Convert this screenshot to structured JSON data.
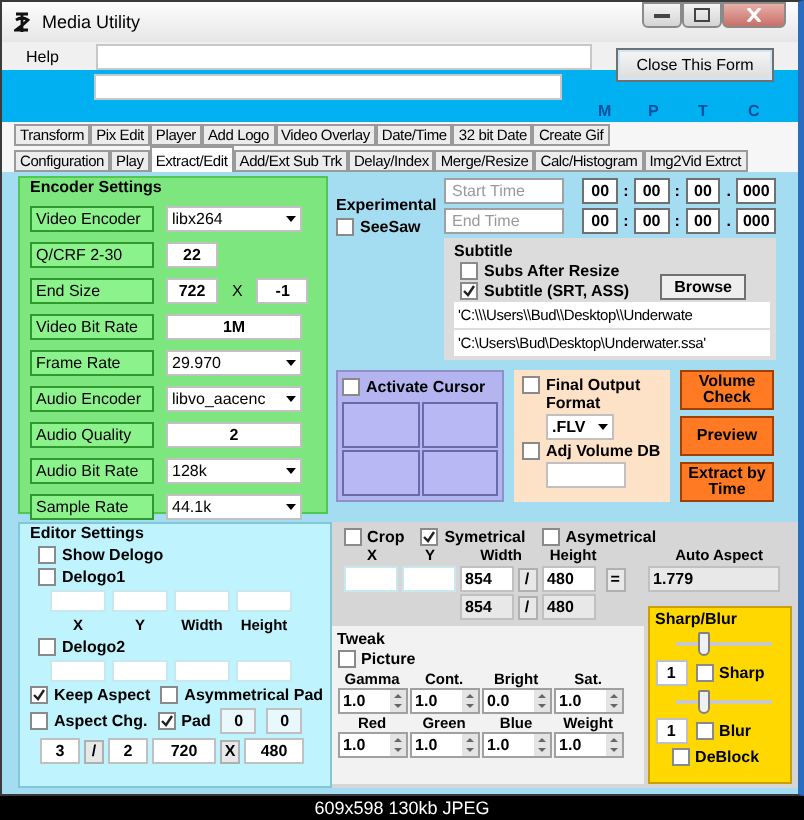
{
  "window": {
    "title": "Media Utility"
  },
  "menu": [
    {
      "label": "Help"
    }
  ],
  "close_button": "Close This Form",
  "indicators": [
    "M",
    "P",
    "T",
    "C"
  ],
  "tabs_row1": [
    {
      "label": "Transform",
      "selected": false
    },
    {
      "label": "Pix Edit",
      "selected": false
    },
    {
      "label": "Player",
      "selected": false
    },
    {
      "label": "Add Logo",
      "selected": false
    },
    {
      "label": "Video Overlay",
      "selected": false
    },
    {
      "label": "Date/Time",
      "selected": false
    },
    {
      "label": "32 bit Date",
      "selected": false
    },
    {
      "label": "Create Gif",
      "selected": false
    }
  ],
  "tabs_row2": [
    {
      "label": "Configuration",
      "selected": false
    },
    {
      "label": "Play",
      "selected": false
    },
    {
      "label": "Extract/Edit",
      "selected": true
    },
    {
      "label": "Add/Ext Sub Trk",
      "selected": false
    },
    {
      "label": "Delay/Index",
      "selected": false
    },
    {
      "label": "Merge/Resize",
      "selected": false
    },
    {
      "label": "Calc/Histogram",
      "selected": false
    },
    {
      "label": "Img2Vid Extrct",
      "selected": false
    }
  ],
  "encoder_settings": {
    "title": "Encoder Settings",
    "rows": [
      {
        "label": "Video Encoder",
        "kind": "dropdown",
        "value": "libx264"
      },
      {
        "label": "Q/CRF  2-30",
        "kind": "short",
        "value": "22"
      },
      {
        "label": "End Size",
        "kind": "size",
        "value": "722",
        "separator": "X",
        "value2": "-1"
      },
      {
        "label": "Video Bit Rate",
        "kind": "field",
        "value": "1M"
      },
      {
        "label": "Frame Rate",
        "kind": "dropdown",
        "value": "29.970"
      },
      {
        "label": "Audio Encoder",
        "kind": "dropdown",
        "value": "libvo_aacenc"
      },
      {
        "label": "Audio Quality",
        "kind": "field",
        "value": "2"
      },
      {
        "label": "Audio Bit Rate",
        "kind": "dropdown",
        "value": "128k"
      },
      {
        "label": "Sample Rate",
        "kind": "dropdown",
        "value": "44.1k"
      }
    ]
  },
  "experimental": {
    "label": "Experimental",
    "seesaw": {
      "label": "SeeSaw",
      "checked": false
    }
  },
  "times": [
    {
      "placeholder": "Start Time",
      "parts": [
        "00",
        "00",
        "00",
        "000"
      ]
    },
    {
      "placeholder": "End Time",
      "parts": [
        "00",
        "00",
        "00",
        "000"
      ]
    }
  ],
  "time_separators": [
    ":",
    ":",
    "."
  ],
  "subtitle": {
    "title": "Subtitle",
    "checks": [
      {
        "label": "Subs After Resize",
        "checked": false
      },
      {
        "label": "Subtitle (SRT, ASS)",
        "checked": true
      }
    ],
    "browse": "Browse",
    "paths": [
      "'C:\\\\\\Users\\\\Bud\\\\Desktop\\\\Underwate",
      "'C:\\Users\\Bud\\Desktop\\Underwater.ssa'"
    ]
  },
  "cursor": {
    "label": "Activate Cursor",
    "checked": false
  },
  "output": {
    "final": {
      "label": "Final Output Format",
      "checked": false
    },
    "format": ".FLV",
    "volume": {
      "label": "Adj Volume DB",
      "checked": false
    }
  },
  "actions": [
    "Volume Check",
    "Preview",
    "Extract by Time"
  ],
  "editor": {
    "title": "Editor Settings",
    "show_delogo": {
      "label": "Show Delogo",
      "checked": false
    },
    "delogo1": {
      "label": "Delogo1",
      "checked": false
    },
    "coord_labels": [
      "X",
      "Y",
      "Width",
      "Height"
    ],
    "delogo2": {
      "label": "Delogo2",
      "checked": false
    },
    "keep_aspect": {
      "label": "Keep Aspect",
      "checked": true
    },
    "asym_pad": {
      "label": "Asymmetrical Pad",
      "checked": false
    },
    "aspect_chg": {
      "label": "Aspect Chg.",
      "checked": false
    },
    "pad": {
      "label": "Pad",
      "checked": true,
      "values": [
        "0",
        "0"
      ]
    },
    "aspect": [
      "3",
      "2"
    ],
    "aspect_separator": "/",
    "size": [
      "720",
      "480"
    ],
    "size_separator": "X"
  },
  "crop": {
    "checks": [
      {
        "label": "Crop",
        "checked": false
      },
      {
        "label": "Symetrical",
        "checked": true
      },
      {
        "label": "Asymetrical",
        "checked": false
      }
    ],
    "labels": [
      "X",
      "Y",
      "Width",
      "Height"
    ],
    "auto_label": "Auto Aspect",
    "row1": [
      "854",
      "480"
    ],
    "row2": [
      "854",
      "480"
    ],
    "separator": "/",
    "equals": "=",
    "auto_value": "1.779"
  },
  "tweak": {
    "title": "Tweak",
    "picture": {
      "label": "Picture",
      "checked": false
    },
    "params": [
      {
        "label": "Gamma",
        "value": "1.0"
      },
      {
        "label": "Cont.",
        "value": "1.0"
      },
      {
        "label": "Bright",
        "value": "0.0"
      },
      {
        "label": "Sat.",
        "value": "1.0"
      },
      {
        "label": "Red",
        "value": "1.0"
      },
      {
        "label": "Green",
        "value": "1.0"
      },
      {
        "label": "Blue",
        "value": "1.0"
      },
      {
        "label": "Weight",
        "value": "1.0"
      }
    ]
  },
  "sharp_blur": {
    "title": "Sharp/Blur",
    "items": [
      {
        "level": 0.3,
        "value": "1",
        "label": "Sharp",
        "checked": false
      },
      {
        "level": 0.3,
        "value": "1",
        "label": "Blur",
        "checked": false
      }
    ],
    "deblock": {
      "label": "DeBlock",
      "checked": false
    }
  },
  "caption": "609x598 130kb JPEG"
}
